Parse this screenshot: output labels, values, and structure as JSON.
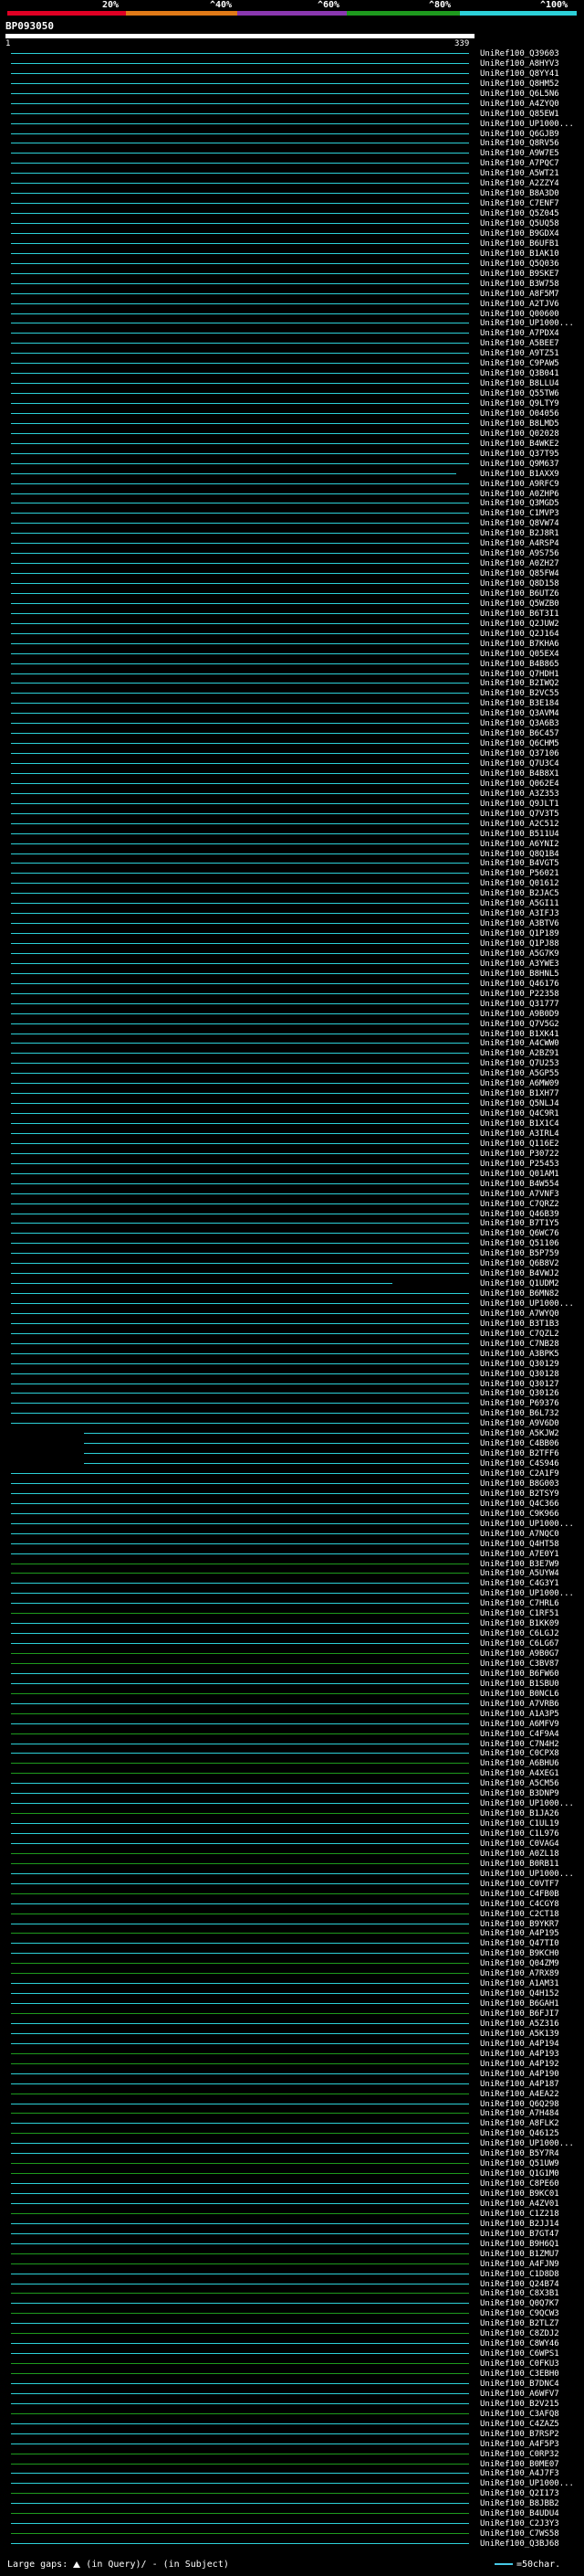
{
  "header": {
    "percent_labels": [
      "20%",
      "^40%",
      "^60%",
      "^80%",
      "^100%"
    ],
    "color_scale": [
      "#e00024",
      "#e07a18",
      "#8a38b0",
      "#1e9a1e",
      "#2cd0d8"
    ]
  },
  "query": {
    "name": "BP093050",
    "start": "1",
    "end": "339"
  },
  "hits": [
    "UniRef100_Q39603",
    "UniRef100_A8HYV3",
    "UniRef100_Q8YY41",
    "UniRef100_Q8HM52",
    "UniRef100_Q6L5N6",
    "UniRef100_A4ZYQ0",
    "UniRef100_Q85EW1",
    "UniRef100_UP1000...",
    "UniRef100_Q6GJB9",
    "UniRef100_Q8RV56",
    "UniRef100_A9W7E5",
    "UniRef100_A7PQC7",
    "UniRef100_A5WT21",
    "UniRef100_A2ZZY4",
    "UniRef100_B8A3D0",
    "UniRef100_C7ENF7",
    "UniRef100_Q5Z045",
    "UniRef100_Q5UQ58",
    "UniRef100_B9GDX4",
    "UniRef100_B6UFB1",
    "UniRef100_B1AK10",
    "UniRef100_Q5Q036",
    "UniRef100_B9SKE7",
    "UniRef100_B3W758",
    "UniRef100_A8F5M7",
    "UniRef100_A2TJV6",
    "UniRef100_Q00600",
    "UniRef100_UP1000...",
    "UniRef100_A7PDX4",
    "UniRef100_A5BEE7",
    "UniRef100_A9TZ51",
    "UniRef100_C9PAW5",
    "UniRef100_Q3B041",
    "UniRef100_B8LLU4",
    "UniRef100_Q55TW6",
    "UniRef100_Q9LTY9",
    "UniRef100_O04056",
    "UniRef100_B8LMD5",
    "UniRef100_Q02028",
    "UniRef100_B4WKE2",
    "UniRef100_Q37T95",
    "UniRef100_Q9M637",
    "UniRef100_B1AXX9",
    "UniRef100_A9RFC9",
    "UniRef100_A0ZHP6",
    "UniRef100_Q3MGD5",
    "UniRef100_C1MVP3",
    "UniRef100_Q8VW74",
    "UniRef100_B2J8R1",
    "UniRef100_A4RSP4",
    "UniRef100_A9S756",
    "UniRef100_A0ZH27",
    "UniRef100_Q85FW4",
    "UniRef100_Q8D158",
    "UniRef100_B6UTZ6",
    "UniRef100_Q5WZB0",
    "UniRef100_B6T3I1",
    "UniRef100_Q2JUW2",
    "UniRef100_Q2J164",
    "UniRef100_B7KHA6",
    "UniRef100_Q05EX4",
    "UniRef100_B4B865",
    "UniRef100_Q7HDH1",
    "UniRef100_B2IWQ2",
    "UniRef100_B2VC55",
    "UniRef100_B3E184",
    "UniRef100_Q3AVM4",
    "UniRef100_Q3A6B3",
    "UniRef100_B6C457",
    "UniRef100_Q6CHM5",
    "UniRef100_Q37106",
    "UniRef100_Q7U3C4",
    "UniRef100_B4B8X1",
    "UniRef100_Q062E4",
    "UniRef100_A3Z353",
    "UniRef100_Q9JLT1",
    "UniRef100_Q7V3T5",
    "UniRef100_A2C512",
    "UniRef100_B511U4",
    "UniRef100_A6YNI2",
    "UniRef100_Q8Q1B4",
    "UniRef100_B4VGT5",
    "UniRef100_P56021",
    "UniRef100_Q01612",
    "UniRef100_B2JAC5",
    "UniRef100_A5GI11",
    "UniRef100_A3IFJ3",
    "UniRef100_A3BTV6",
    "UniRef100_Q1P189",
    "UniRef100_Q1PJ88",
    "UniRef100_A5G7K9",
    "UniRef100_A3YWE3",
    "UniRef100_B8HNL5",
    "UniRef100_Q46176",
    "UniRef100_P22358",
    "UniRef100_Q31777",
    "UniRef100_A9B0D9",
    "UniRef100_Q7V5G2",
    "UniRef100_B1XK41",
    "UniRef100_A4CWW0",
    "UniRef100_A2BZ91",
    "UniRef100_Q7U253",
    "UniRef100_A5GP55",
    "UniRef100_A6MW09",
    "UniRef100_B1XH77",
    "UniRef100_Q5NLJ4",
    "UniRef100_Q4C9R1",
    "UniRef100_B1X1C4",
    "UniRef100_A3IRL4",
    "UniRef100_Q116E2",
    "UniRef100_P30722",
    "UniRef100_P25453",
    "UniRef100_Q01AM1",
    "UniRef100_B4W554",
    "UniRef100_A7VNF3",
    "UniRef100_C7QRZ2",
    "UniRef100_Q46B39",
    "UniRef100_B7T1Y5",
    "UniRef100_Q6WC76",
    "UniRef100_Q51106",
    "UniRef100_B5P759",
    "UniRef100_Q6B8V2",
    "UniRef100_B4VWJ2",
    "UniRef100_Q1UDM2",
    "UniRef100_B6MN82",
    "UniRef100_UP1000...",
    "UniRef100_A7WYQ0",
    "UniRef100_B3T1B3",
    "UniRef100_C7QZL2",
    "UniRef100_C7NB28",
    "UniRef100_A3BPK5",
    "UniRef100_Q30129",
    "UniRef100_Q30128",
    "UniRef100_Q30127",
    "UniRef100_Q30126",
    "UniRef100_P69376",
    "UniRef100_B6L732",
    "UniRef100_A9V6D0",
    "UniRef100_A5KJW2",
    "UniRef100_C4BB06",
    "UniRef100_B2TFF6",
    "UniRef100_C4S946",
    "UniRef100_C2A1F9",
    "UniRef100_B8G003",
    "UniRef100_B2TSY9",
    "UniRef100_Q4C366",
    "UniRef100_C9K966",
    "UniRef100_UP1000...",
    "UniRef100_A7NQC0",
    "UniRef100_Q4HT58",
    "UniRef100_A7E0Y1",
    "UniRef100_B3E7W9",
    "UniRef100_A5UYW4",
    "UniRef100_C4G3Y1",
    "UniRef100_UP1000...",
    "UniRef100_C7HRL6",
    "UniRef100_C1RF51",
    "UniRef100_B1KK09",
    "UniRef100_C6LGJ2",
    "UniRef100_C6LG67",
    "UniRef100_A9B0G7",
    "UniRef100_C3BV87",
    "UniRef100_B6FW60",
    "UniRef100_B1SBU0",
    "UniRef100_B0NCL6",
    "UniRef100_A7VRB6",
    "UniRef100_A1A3P5",
    "UniRef100_A6MFV9",
    "UniRef100_C4F9A4",
    "UniRef100_C7N4H2",
    "UniRef100_C0CPX8",
    "UniRef100_A6BHU6",
    "UniRef100_A4XEG1",
    "UniRef100_A5CM56",
    "UniRef100_B3DNP9",
    "UniRef100_UP1000...",
    "UniRef100_B1JA26",
    "UniRef100_C1UL19",
    "UniRef100_C1L976",
    "UniRef100_C0VAG4",
    "UniRef100_A0ZL18",
    "UniRef100_B0RB11",
    "UniRef100_UP1000...",
    "UniRef100_C0VTF7",
    "UniRef100_C4FB0B",
    "UniRef100_C4CGY8",
    "UniRef100_C2CT18",
    "UniRef100_B9YKR7",
    "UniRef100_A4P195",
    "UniRef100_Q47TI0",
    "UniRef100_B9KCH0",
    "UniRef100_Q04ZM9",
    "UniRef100_A7RX89",
    "UniRef100_A1AM31",
    "UniRef100_Q4H152",
    "UniRef100_B6GAH1",
    "UniRef100_B6FJI7",
    "UniRef100_A5Z316",
    "UniRef100_A5K139",
    "UniRef100_A4P194",
    "UniRef100_A4P193",
    "UniRef100_A4P192",
    "UniRef100_A4P190",
    "UniRef100_A4P187",
    "UniRef100_A4EA22",
    "UniRef100_Q6Q298",
    "UniRef100_A7H484",
    "UniRef100_A8FLK2",
    "UniRef100_Q46125",
    "UniRef100_UP1000...",
    "UniRef100_B5Y7R4",
    "UniRef100_Q51UW9",
    "UniRef100_Q1G1M0",
    "UniRef100_C8PE60",
    "UniRef100_B9KC01",
    "UniRef100_A4ZV01",
    "UniRef100_C1Z218",
    "UniRef100_B2JJ14",
    "UniRef100_B7GT47",
    "UniRef100_B9H6Q1",
    "UniRef100_B1ZMU7",
    "UniRef100_A4FJN9",
    "UniRef100_C1D8D8",
    "UniRef100_Q24B74",
    "UniRef100_C8X3B1",
    "UniRef100_Q0Q7K7",
    "UniRef100_C9QCW3",
    "UniRef100_B2TLZ7",
    "UniRef100_C8ZDJ2",
    "UniRef100_C8WY46",
    "UniRef100_C6WPS1",
    "UniRef100_C0FKU3",
    "UniRef100_C3EBH0",
    "UniRef100_B7DNC4",
    "UniRef100_A6WFV7",
    "UniRef100_B2V215",
    "UniRef100_C3AFQ8",
    "UniRef100_C4ZAZ5",
    "UniRef100_B7RSP2",
    "UniRef100_A4F5P3",
    "UniRef100_C0RP32",
    "UniRef100_B0ME07",
    "UniRef100_A4J7F3",
    "UniRef100_UP1000...",
    "UniRef100_Q2I173",
    "UniRef100_B8JBB2",
    "UniRef100_B4UDU4",
    "UniRef100_C2J3Y3",
    "UniRef100_C7WS58",
    "UniRef100_Q3BJ68"
  ],
  "legend": {
    "large_gaps": "Large gaps:",
    "in_query": "(in Query)/",
    "dash": "-",
    "in_subject": "(in Subject)",
    "scale": "=50char."
  }
}
